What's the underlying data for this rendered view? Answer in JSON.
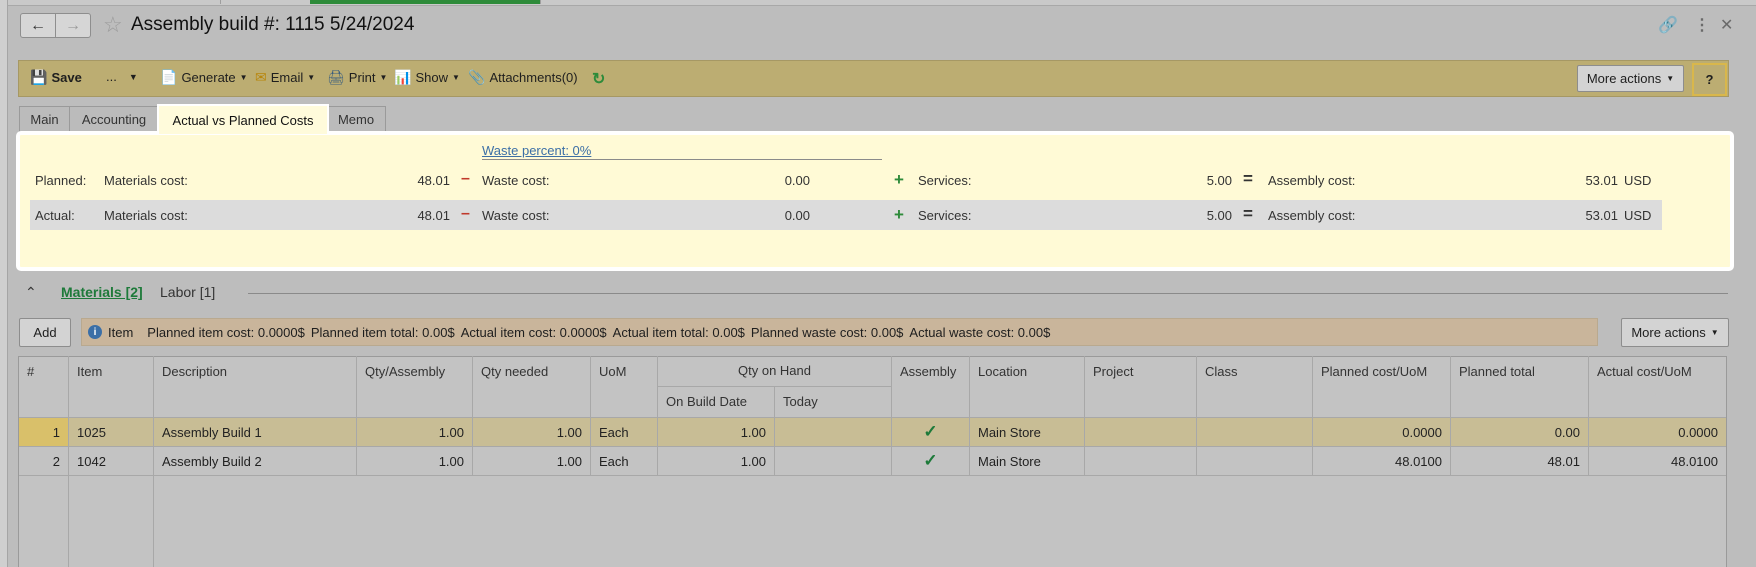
{
  "header": {
    "title": "Assembly build #: 1115 5/24/2024"
  },
  "toolbar": {
    "save": "Save",
    "more": "...",
    "generate": "Generate",
    "email": "Email",
    "print": "Print",
    "show": "Show",
    "attachments": "Attachments(0)",
    "more_actions": "More actions",
    "help": "?"
  },
  "tabs": [
    "Main",
    "Accounting",
    "Actual vs Planned Costs",
    "Memo"
  ],
  "costs": {
    "waste_percent": "Waste percent: 0%",
    "planned": {
      "label": "Planned:",
      "materials_label": "Materials cost:",
      "materials": "48.01",
      "waste_label": "Waste cost:",
      "waste": "0.00",
      "services_label": "Services:",
      "services": "5.00",
      "assembly_label": "Assembly cost:",
      "assembly": "53.01",
      "currency": "USD"
    },
    "actual": {
      "label": "Actual:",
      "materials_label": "Materials cost:",
      "materials": "48.01",
      "waste_label": "Waste cost:",
      "waste": "0.00",
      "services_label": "Services:",
      "services": "5.00",
      "assembly_label": "Assembly cost:",
      "assembly": "53.01",
      "currency": "USD"
    }
  },
  "subtabs": {
    "materials": "Materials [2]",
    "labor": "Labor [1]"
  },
  "grid_toolbar": {
    "add": "Add",
    "info_item": "Item",
    "info": [
      "Planned item cost: 0.0000$",
      "Planned item total: 0.00$",
      "Actual item cost: 0.0000$",
      "Actual item total: 0.00$",
      "Planned waste cost: 0.00$",
      "Actual waste cost: 0.00$"
    ],
    "more_actions": "More actions"
  },
  "grid": {
    "headers": {
      "num": "#",
      "item": "Item",
      "description": "Description",
      "qty_assembly": "Qty/Assembly",
      "qty_needed": "Qty needed",
      "uom": "UoM",
      "qty_on_hand": "Qty on Hand",
      "on_build_date": "On Build Date",
      "today": "Today",
      "assembly": "Assembly",
      "location": "Location",
      "project": "Project",
      "class": "Class",
      "planned_cost_uom": "Planned cost/UoM",
      "planned_total": "Planned total",
      "actual_cost_uom": "Actual cost/UoM"
    },
    "rows": [
      {
        "num": "1",
        "item": "1025",
        "description": "Assembly Build 1",
        "qty_assembly": "1.00",
        "qty_needed": "1.00",
        "uom": "Each",
        "on_build_date": "1.00",
        "today": "",
        "assembly": true,
        "location": "Main Store",
        "project": "",
        "class": "",
        "planned_cost_uom": "0.0000",
        "planned_total": "0.00",
        "actual_cost_uom": "0.0000"
      },
      {
        "num": "2",
        "item": "1042",
        "description": "Assembly Build 2",
        "qty_assembly": "1.00",
        "qty_needed": "1.00",
        "uom": "Each",
        "on_build_date": "1.00",
        "today": "",
        "assembly": true,
        "location": "Main Store",
        "project": "",
        "class": "",
        "planned_cost_uom": "48.0100",
        "planned_total": "48.01",
        "actual_cost_uom": "48.0100"
      }
    ]
  }
}
